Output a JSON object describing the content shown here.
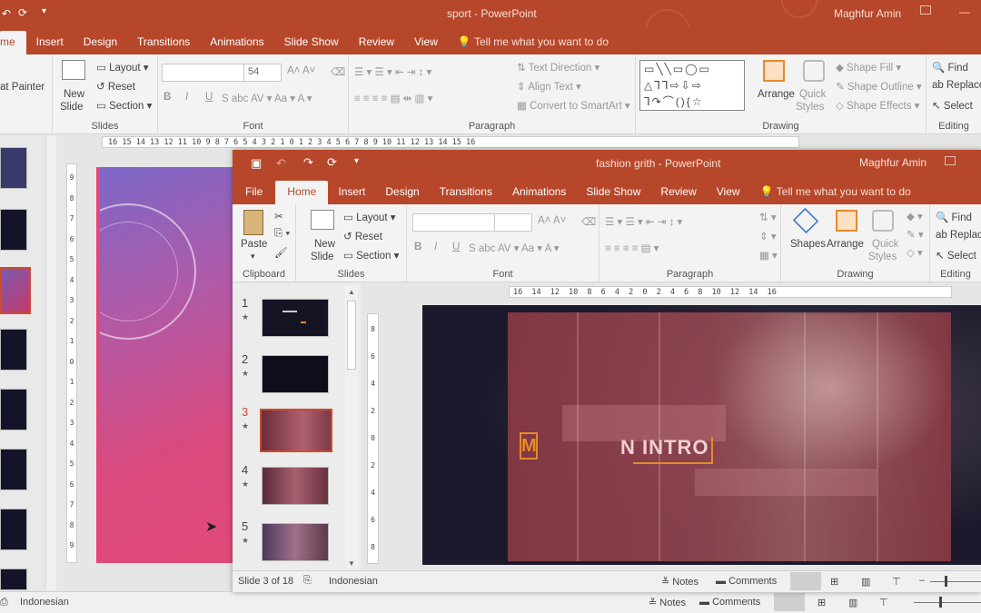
{
  "back_window": {
    "title": "sport  -  PowerPoint",
    "user": "Maghfur Amin",
    "tabs": [
      "me",
      "Insert",
      "Design",
      "Transitions",
      "Animations",
      "Slide Show",
      "Review",
      "View"
    ],
    "tellme": "Tell me what you want to do",
    "clipboard": {
      "format_painter": "at Painter"
    },
    "slides_group": {
      "label": "Slides",
      "new_slide": "New",
      "new_slide2": "Slide",
      "layout": "Layout",
      "reset": "Reset",
      "section": "Section"
    },
    "font_group": {
      "label": "Font",
      "size": "54"
    },
    "paragraph_group": {
      "label": "Paragraph",
      "text_direction": "Text Direction",
      "align_text": "Align Text",
      "convert_smartart": "Convert to SmartArt"
    },
    "drawing_group": {
      "label": "Drawing",
      "arrange": "Arrange",
      "quick_styles": "Quick",
      "quick_styles2": "Styles",
      "shape_fill": "Shape Fill",
      "shape_outline": "Shape Outline",
      "shape_effects": "Shape Effects"
    },
    "editing_group": {
      "label": "Editing",
      "find": "Find",
      "replace": "Replace",
      "select": "Select"
    },
    "ruler": "16 15 14 13 12 11 10  9  8  7  6  5  4  3  2  1  0  1  2  3  4  5  6  7  8  9 10 11 12 13 14 15 16",
    "vruler": "9 8 7 6 5 4 3 2 1 0 1 2 3 4 5 6 7 8 9",
    "status": {
      "language": "Indonesian",
      "notes": "Notes",
      "comments": "Comments"
    }
  },
  "front_window": {
    "title": "fashion grith  -  PowerPoint",
    "user": "Maghfur Amin",
    "tabs": [
      "File",
      "Home",
      "Insert",
      "Design",
      "Transitions",
      "Animations",
      "Slide Show",
      "Review",
      "View"
    ],
    "active_tab": "Home",
    "tellme": "Tell me what you want to do",
    "clipboard": {
      "label": "Clipboard",
      "paste": "Paste"
    },
    "slides_group": {
      "label": "Slides",
      "new_slide": "New",
      "new_slide2": "Slide",
      "layout": "Layout",
      "reset": "Reset",
      "section": "Section"
    },
    "font_group": {
      "label": "Font"
    },
    "paragraph_group": {
      "label": "Paragraph"
    },
    "drawing_group": {
      "label": "Drawing",
      "shapes": "Shapes",
      "arrange": "Arrange",
      "quick_styles": "Quick",
      "quick_styles2": "Styles"
    },
    "editing_group": {
      "label": "Editing",
      "find": "Find",
      "replace": "Replac",
      "select": "Select"
    },
    "ruler": "16 14 12 10  8  6  4  2  0  2  4  6  8 10 12 14 16",
    "vruler": "8 6 4 2 0 2 4 6 8",
    "thumbnails": [
      {
        "num": "1",
        "star": "★"
      },
      {
        "num": "2",
        "star": "★"
      },
      {
        "num": "3",
        "star": "★"
      },
      {
        "num": "4",
        "star": "★"
      },
      {
        "num": "5",
        "star": "★"
      }
    ],
    "selected_slide": "3",
    "slide_text": {
      "left_letter": "M",
      "intro": "N INTRO"
    },
    "status": {
      "slide_info": "Slide 3 of 18",
      "language": "Indonesian",
      "notes": "Notes",
      "comments": "Comments"
    }
  },
  "colors": {
    "accent": "#b7472a",
    "selected_thumb": "#d04a2a",
    "slide_bg": "#1b1a2c",
    "overlay": "#8b3a45",
    "intro_orange": "#e48b2c"
  }
}
